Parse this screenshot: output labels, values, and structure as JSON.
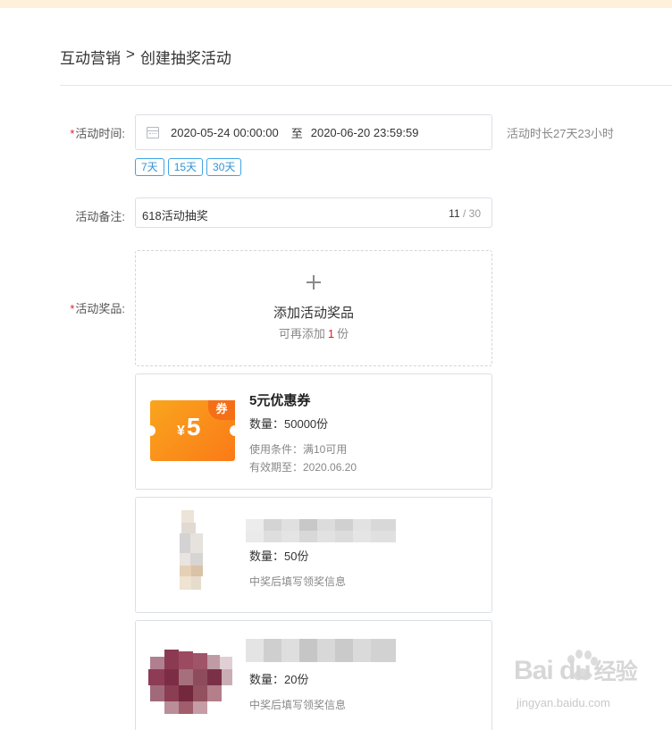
{
  "breadcrumb": {
    "parent": "互动营销",
    "separator": ">",
    "current": "创建抽奖活动"
  },
  "form": {
    "activity_time": {
      "required_mark": "*",
      "label": "活动时间:",
      "start": "2020-05-24 00:00:00",
      "separator": "至",
      "end": "2020-06-20 23:59:59",
      "duration": "活动时长27天23小时",
      "quick_options": [
        "7天",
        "15天",
        "30天"
      ]
    },
    "remark": {
      "label": "活动备注:",
      "value": "618活动抽奖",
      "count": "11",
      "count_sep": " / ",
      "max": "30"
    },
    "prizes": {
      "required_mark": "*",
      "label": "活动奖品:",
      "add": {
        "title": "添加活动奖品",
        "sub_prefix": "可再添加",
        "remaining": "1",
        "sub_suffix": "份"
      },
      "items": [
        {
          "title": "5元优惠券",
          "coupon_currency": "¥",
          "coupon_amount": "5",
          "coupon_tag": "券",
          "quantity": "数量：50000份",
          "condition": "使用条件：满10可用",
          "expiry": "有效期至：2020.06.20"
        },
        {
          "quantity": "数量：50份",
          "note": "中奖后填写领奖信息"
        },
        {
          "quantity": "数量：20份",
          "note": "中奖后填写领奖信息"
        }
      ]
    }
  },
  "watermark": {
    "brand": "Bai du",
    "brand_cn": "经验",
    "url": "jingyan.baidu.com"
  },
  "colors": {
    "accent_blue": "#2f92d6",
    "required_red": "#e02020",
    "coupon_orange": "#fb7a17",
    "top_strip": "#fdf1dc"
  }
}
